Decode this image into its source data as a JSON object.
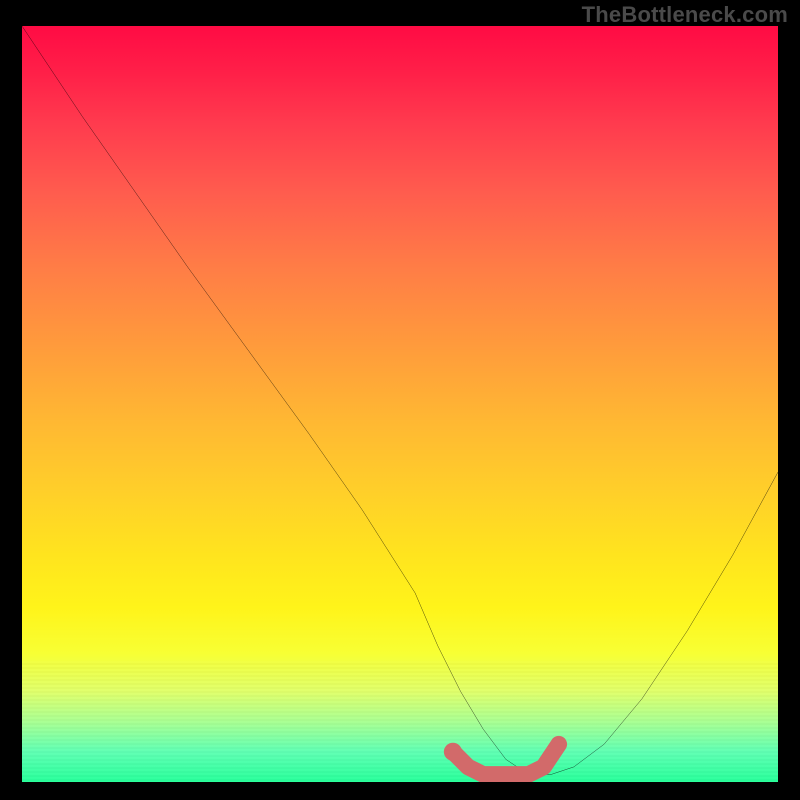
{
  "watermark": "TheBottleneck.com",
  "chart_data": {
    "type": "line",
    "title": "",
    "xlabel": "",
    "ylabel": "",
    "xlim": [
      0,
      100
    ],
    "ylim": [
      0,
      100
    ],
    "series": [
      {
        "name": "bottleneck-curve",
        "color": "#000000",
        "x": [
          0,
          8,
          15,
          22,
          30,
          38,
          45,
          52,
          55,
          58,
          61,
          64,
          67,
          70,
          73,
          77,
          82,
          88,
          94,
          100
        ],
        "values": [
          100,
          88,
          78,
          68,
          57,
          46,
          36,
          25,
          18,
          12,
          7,
          3,
          1,
          1,
          2,
          5,
          11,
          20,
          30,
          41
        ]
      }
    ],
    "marker_segment": {
      "name": "optimal-range",
      "color": "#d26a6a",
      "x": [
        57,
        59,
        61,
        63,
        65,
        67,
        69,
        71
      ],
      "values": [
        4,
        2,
        1,
        1,
        1,
        1,
        2,
        5
      ]
    },
    "marker_point": {
      "name": "selected-point",
      "color": "#d26a6a",
      "x": 57,
      "value": 4
    },
    "background_gradient": {
      "top": "#ff0b44",
      "mid": "#ffe41e",
      "bottom": "#27ff9a"
    }
  }
}
